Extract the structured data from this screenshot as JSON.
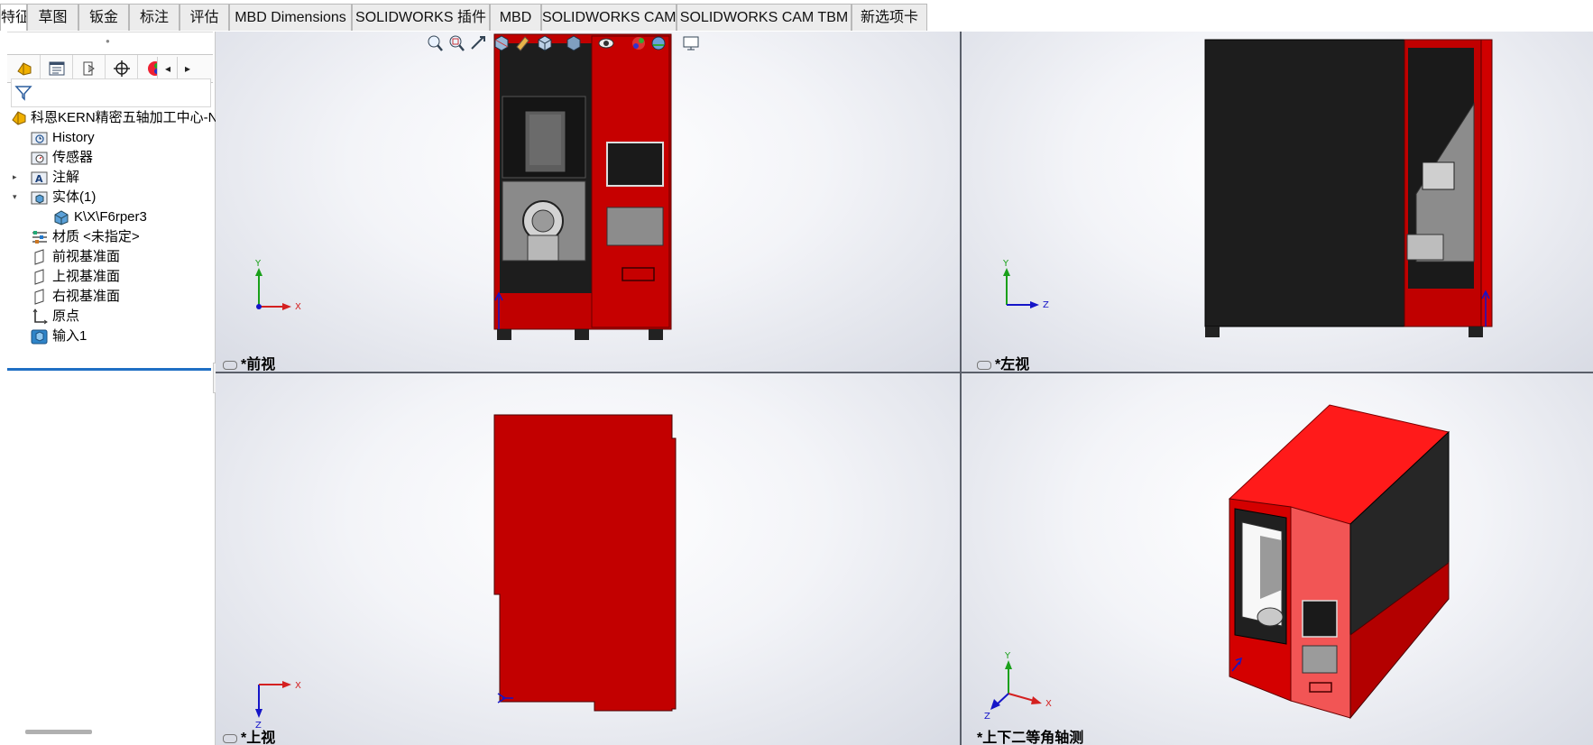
{
  "tabs": [
    "特征",
    "草图",
    "钣金",
    "标注",
    "评估",
    "MBD Dimensions",
    "SOLIDWORKS 插件",
    "MBD",
    "SOLIDWORKS CAM",
    "SOLIDWORKS CAM TBM",
    "新选项卡"
  ],
  "feature_manager": {
    "tab_icons": [
      "feature-manager-icon",
      "property-manager-icon",
      "configuration-manager-icon",
      "dimxpert-manager-icon",
      "display-manager-icon"
    ],
    "scroll_left": "◂",
    "scroll_right": "▸",
    "filter_icon": "filter-icon",
    "root": {
      "label": "科恩KERN精密五轴加工中心-N",
      "icon": "part-icon"
    },
    "items": [
      {
        "label": "History",
        "icon": "history-folder-icon"
      },
      {
        "label": "传感器",
        "icon": "sensors-folder-icon"
      },
      {
        "label": "注解",
        "icon": "annotations-folder-icon",
        "expander": "▸"
      },
      {
        "label": "实体(1)",
        "icon": "solid-bodies-folder-icon",
        "expander": "▾"
      },
      {
        "label": "K\\X\\F6rper3",
        "icon": "solid-body-icon"
      },
      {
        "label": "材质 <未指定>",
        "icon": "material-icon"
      },
      {
        "label": "前视基准面",
        "icon": "plane-icon"
      },
      {
        "label": "上视基准面",
        "icon": "plane-icon"
      },
      {
        "label": "右视基准面",
        "icon": "plane-icon"
      },
      {
        "label": "原点",
        "icon": "origin-icon"
      },
      {
        "label": "输入1",
        "icon": "imported-feature-icon"
      }
    ]
  },
  "heads_up_toolbar": [
    "zoom-to-fit-icon",
    "zoom-to-area-icon",
    "previous-view-icon",
    "section-view-icon",
    "dynamic-annotation-icon",
    "view-orientation-icon",
    "display-style-icon",
    "hide-show-items-icon",
    "edit-appearance-icon",
    "apply-scene-icon",
    "view-settings-icon"
  ],
  "viewports": {
    "front": {
      "label": "*前视",
      "triad": [
        "Y",
        "X"
      ]
    },
    "left": {
      "label": "*左视",
      "triad": [
        "Y",
        "Z"
      ]
    },
    "top": {
      "label": "*上视",
      "triad": [
        "X",
        "Z"
      ]
    },
    "dimetric": {
      "label": "*上下二等角轴测",
      "triad": [
        "Y",
        "X",
        "Z"
      ]
    }
  },
  "colors": {
    "machine_red": "#c00000",
    "machine_red_light": "#ff1a1a",
    "machine_dark": "#1c1c1c",
    "selection_blue": "#1f6fc4",
    "axis_x": "#d42020",
    "axis_y": "#1aa01a",
    "axis_z": "#1515c8"
  }
}
